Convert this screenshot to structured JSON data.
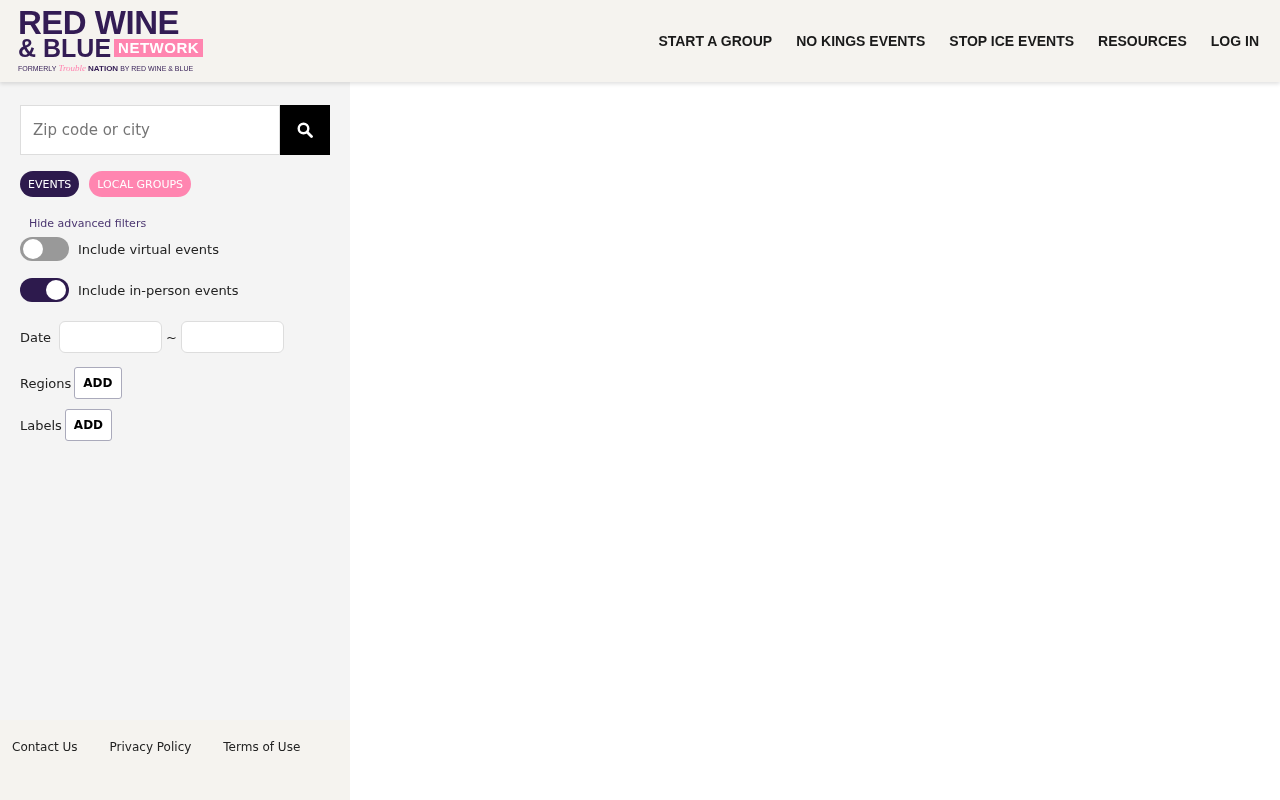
{
  "logo": {
    "line_1": "RED WINE",
    "line_2": "& BLUE",
    "badge": "NETWORK",
    "tagline_start": "FORMERLY",
    "tagline_script": "Trouble",
    "tagline_bold": "NATION",
    "tagline_end": "BY RED WINE & BLUE"
  },
  "nav": [
    "START A GROUP",
    "NO KINGS EVENTS",
    "STOP ICE EVENTS",
    "RESOURCES",
    "LOG IN"
  ],
  "search": {
    "placeholder": "Zip code or city"
  },
  "tabs": [
    {
      "label": "EVENTS",
      "selected": true
    },
    {
      "label": "LOCAL GROUPS",
      "selected": false
    }
  ],
  "filters_link": "Hide advanced filters",
  "toggles": [
    {
      "label": "Include virtual events",
      "on": false
    },
    {
      "label": "Include in-person events",
      "on": true
    }
  ],
  "date": {
    "label": "Date",
    "separator": "~"
  },
  "pickers": [
    {
      "label": "Regions",
      "button": "ADD"
    },
    {
      "label": "Labels",
      "button": "ADD"
    }
  ],
  "footer": [
    "Contact Us",
    "Privacy Policy",
    "Terms of Use"
  ]
}
